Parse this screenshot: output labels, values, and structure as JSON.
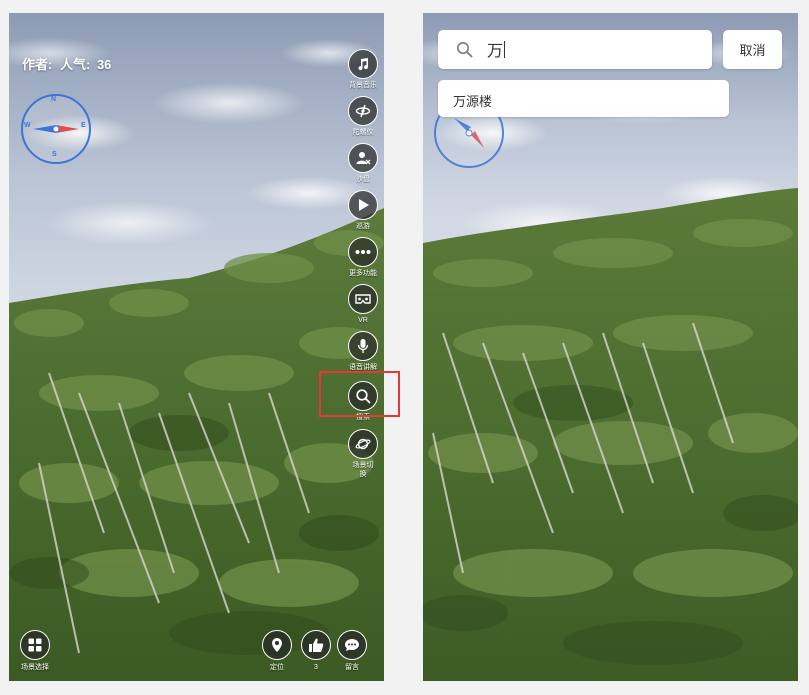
{
  "left": {
    "author": {
      "label": "作者:",
      "popularity_label": "人气:",
      "popularity_value": "36"
    },
    "compass": {
      "n": "N",
      "e": "E",
      "s": "S",
      "w": "W"
    },
    "tools": [
      {
        "id": "music",
        "label": "背景音乐",
        "icon": "music-note-icon"
      },
      {
        "id": "gyro",
        "label": "陀螺仪",
        "icon": "gyroscope-icon"
      },
      {
        "id": "sandbox",
        "label": "沙盘",
        "icon": "sandbox-user-icon"
      },
      {
        "id": "tour",
        "label": "巡游",
        "icon": "play-icon"
      },
      {
        "id": "more",
        "label": "更多功能",
        "icon": "more-dots-icon"
      },
      {
        "id": "vr",
        "label": "VR",
        "icon": "vr-goggles-icon"
      },
      {
        "id": "voice",
        "label": "语音讲解",
        "icon": "microphone-icon"
      },
      {
        "id": "search",
        "label": "搜索",
        "icon": "search-icon"
      },
      {
        "id": "scene-switch",
        "label": "场景切换",
        "icon": "planet-icon"
      }
    ],
    "bottom": {
      "scene_select": "场景选择",
      "locate": "定位",
      "like_count": "3",
      "comment": "留言"
    }
  },
  "right": {
    "search": {
      "value": "万"
    },
    "cancel_label": "取消",
    "suggestions": [
      "万源楼"
    ]
  },
  "colors": {
    "highlight_box": "#e53935",
    "compass": "#3c74d8",
    "button_bg": "#2b2b2b"
  }
}
